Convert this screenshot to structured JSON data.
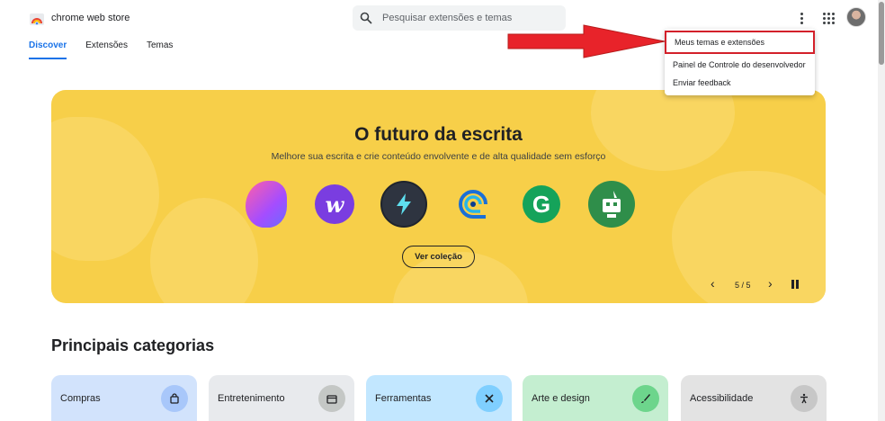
{
  "header": {
    "brand": "chrome web store",
    "search_placeholder": "Pesquisar extensões e temas",
    "icons": [
      "chrome-rainbow-logo",
      "search-icon",
      "more-vert-icon",
      "apps-grid-icon",
      "avatar"
    ]
  },
  "tabs": [
    {
      "label": "Discover",
      "active": true
    },
    {
      "label": "Extensões",
      "active": false
    },
    {
      "label": "Temas",
      "active": false
    }
  ],
  "menu": {
    "items": [
      {
        "label": "Meus temas e extensões",
        "highlighted": true
      },
      {
        "label": "Painel de Controle do desenvolvedor",
        "highlighted": false
      },
      {
        "label": "Enviar feedback",
        "highlighted": false
      }
    ],
    "highlight_color": "#d3202a"
  },
  "banner": {
    "title": "O futuro da escrita",
    "subtitle": "Melhore sua escrita e crie conteúdo envolvente e de alta qualidade sem esforço",
    "cta": "Ver coleção",
    "counter": "5 / 5",
    "background": "#f7cf49",
    "extension_icons": [
      "ext-gradient-icon",
      "ext-w-icon",
      "ext-lightning-icon",
      "ext-spiral-icon",
      "ext-g-icon",
      "ext-robot-icon"
    ],
    "ext_w_letter": "w",
    "ext_g_letter": "G"
  },
  "categories": {
    "title": "Principais categorias",
    "items": [
      {
        "label": "Compras",
        "icon": "shopping-bag-icon"
      },
      {
        "label": "Entretenimento",
        "icon": "clapperboard-icon"
      },
      {
        "label": "Ferramentas",
        "icon": "tools-icon"
      },
      {
        "label": "Arte e design",
        "icon": "brush-icon"
      },
      {
        "label": "Acessibilidade",
        "icon": "accessibility-icon"
      }
    ]
  },
  "annotation": {
    "arrow_color": "#e8232a"
  }
}
